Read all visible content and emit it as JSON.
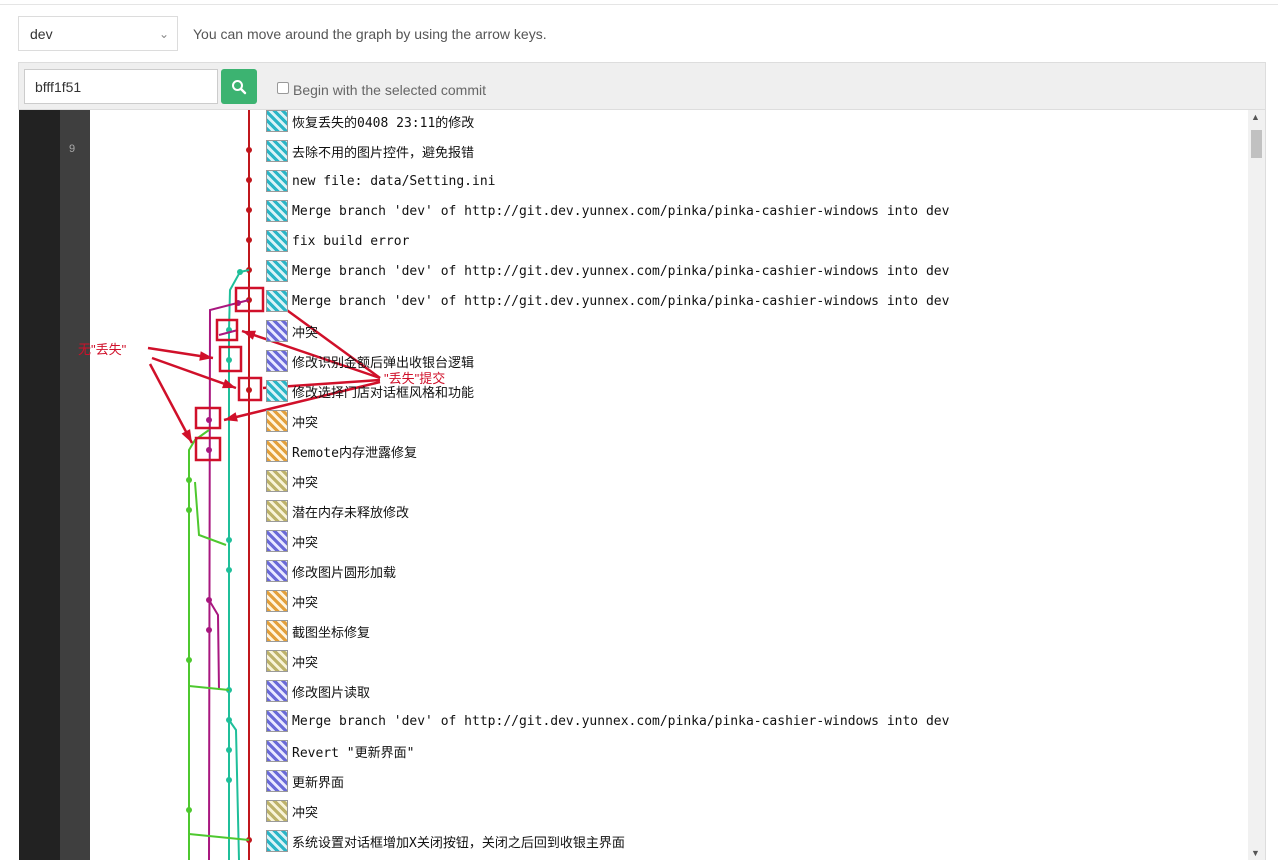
{
  "branch_select": {
    "value": "dev"
  },
  "hint": "You can move around the graph by using the arrow keys.",
  "search": {
    "value": "bfff1f51"
  },
  "begin_checkbox": {
    "label": "Begin with the selected commit",
    "checked": false
  },
  "line_number": "9",
  "commits": [
    {
      "message": "恢复丢失的0408 23:11的修改",
      "avatar": "teal"
    },
    {
      "message": "去除不用的图片控件，避免报错",
      "avatar": "teal"
    },
    {
      "message": "new file: data/Setting.ini",
      "avatar": "teal"
    },
    {
      "message": "Merge branch 'dev' of http://git.dev.yunnex.com/pinka/pinka-cashier-windows into dev",
      "avatar": "teal"
    },
    {
      "message": "fix build error",
      "avatar": "teal"
    },
    {
      "message": "Merge branch 'dev' of http://git.dev.yunnex.com/pinka/pinka-cashier-windows into dev",
      "avatar": "teal"
    },
    {
      "message": "Merge branch 'dev' of http://git.dev.yunnex.com/pinka/pinka-cashier-windows into dev",
      "avatar": "teal"
    },
    {
      "message": "冲突",
      "avatar": "blue"
    },
    {
      "message": "修改识别金额后弹出收银台逻辑",
      "avatar": "blue"
    },
    {
      "message": "修改选择门店对话框风格和功能",
      "avatar": "teal"
    },
    {
      "message": "冲突",
      "avatar": "orange"
    },
    {
      "message": "Remote内存泄露修复",
      "avatar": "orange"
    },
    {
      "message": "冲突",
      "avatar": "olive"
    },
    {
      "message": "潜在内存未释放修改",
      "avatar": "olive"
    },
    {
      "message": "冲突",
      "avatar": "blue"
    },
    {
      "message": "修改图片圆形加载",
      "avatar": "blue"
    },
    {
      "message": "冲突",
      "avatar": "orange"
    },
    {
      "message": "截图坐标修复",
      "avatar": "orange"
    },
    {
      "message": "冲突",
      "avatar": "olive"
    },
    {
      "message": "修改图片读取",
      "avatar": "blue"
    },
    {
      "message": "Merge branch 'dev' of http://git.dev.yunnex.com/pinka/pinka-cashier-windows into dev",
      "avatar": "blue"
    },
    {
      "message": "Revert \"更新界面\"",
      "avatar": "blue"
    },
    {
      "message": "更新界面",
      "avatar": "blue"
    },
    {
      "message": "冲突",
      "avatar": "olive"
    },
    {
      "message": "系统设置对话框增加X关闭按钮，关闭之后回到收银主界面",
      "avatar": "teal"
    }
  ],
  "annotations": {
    "left": "无\"丢失\"",
    "right": "\"丢失\"提交"
  },
  "colors": {
    "red": "#c0161c",
    "teal": "#1fbf9a",
    "magenta": "#a8177f",
    "green": "#4ec82f",
    "annotation": "#d0102a",
    "search_button": "#3cb371"
  },
  "icons": {
    "search": "search-icon",
    "dropdown": "chevron-down-icon"
  }
}
